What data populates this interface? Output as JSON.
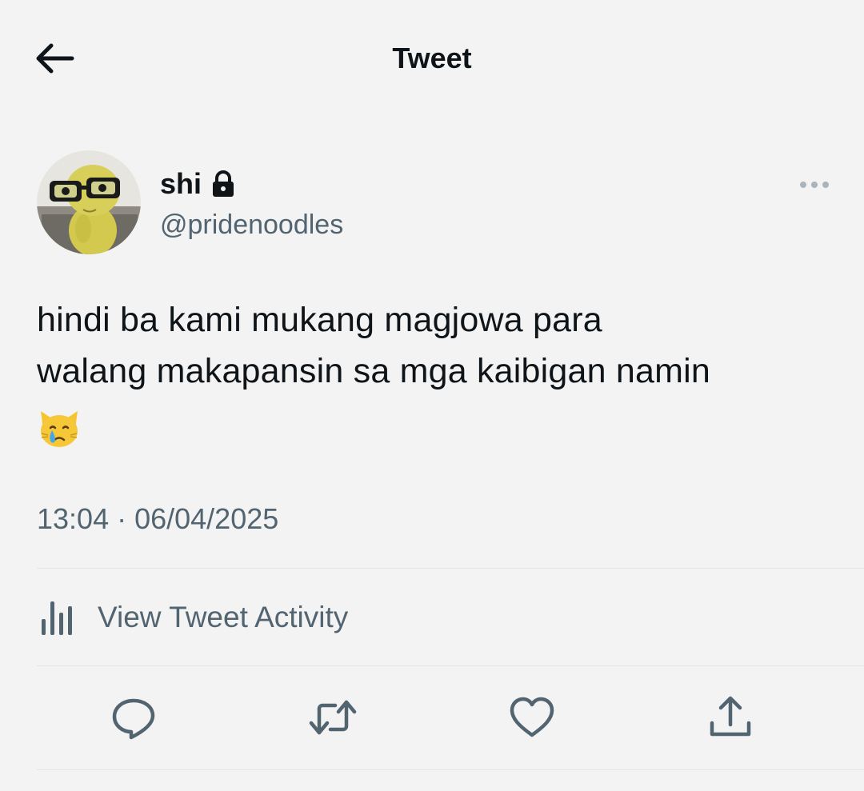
{
  "header": {
    "back_icon": "arrow-left-icon",
    "title": "Tweet"
  },
  "tweet": {
    "author": {
      "display_name": "shi",
      "protected_icon": "lock-icon",
      "handle": "@pridenoodles",
      "avatar": "avatar-image"
    },
    "more_icon": "more-horizontal-icon",
    "text_lines": [
      "hindi ba kami mukang magjowa para",
      "walang makapansin sa mga kaibigan namin"
    ],
    "emoji": "😿",
    "timestamp": "13:04 · 06/04/2025"
  },
  "activity": {
    "icon": "bar-chart-icon",
    "label": "View Tweet Activity"
  },
  "actions": [
    {
      "name": "reply",
      "icon": "reply-icon"
    },
    {
      "name": "retweet",
      "icon": "retweet-icon"
    },
    {
      "name": "like",
      "icon": "heart-icon"
    },
    {
      "name": "share",
      "icon": "share-icon"
    }
  ],
  "colors": {
    "background": "#f3f3f3",
    "primary_text": "#0f1419",
    "secondary_text": "#536471",
    "divider": "#e3e6e8"
  }
}
